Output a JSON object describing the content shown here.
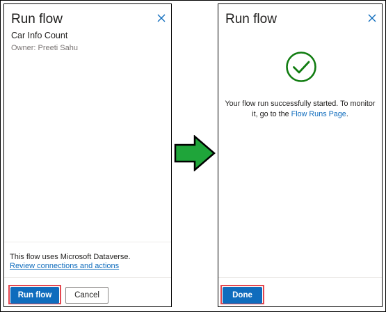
{
  "left_panel": {
    "title": "Run flow",
    "flow_name": "Car Info Count",
    "owner": "Owner: Preeti Sahu",
    "uses_text": "This flow uses Microsoft Dataverse.",
    "review_link": "Review connections and actions",
    "run_button": "Run flow",
    "cancel_button": "Cancel"
  },
  "right_panel": {
    "title": "Run flow",
    "message_prefix": "Your flow run successfully started. To monitor it, go to the",
    "message_link": "Flow Runs Page",
    "message_suffix": ".",
    "done_button": "Done"
  },
  "colors": {
    "accent": "#0f6cbd",
    "success": "#107c10",
    "highlight": "#e4474f",
    "arrow": "#1fa53a"
  },
  "icons": {
    "close": "close-icon",
    "success": "checkmark-circle-icon",
    "arrow": "arrow-right-icon"
  }
}
